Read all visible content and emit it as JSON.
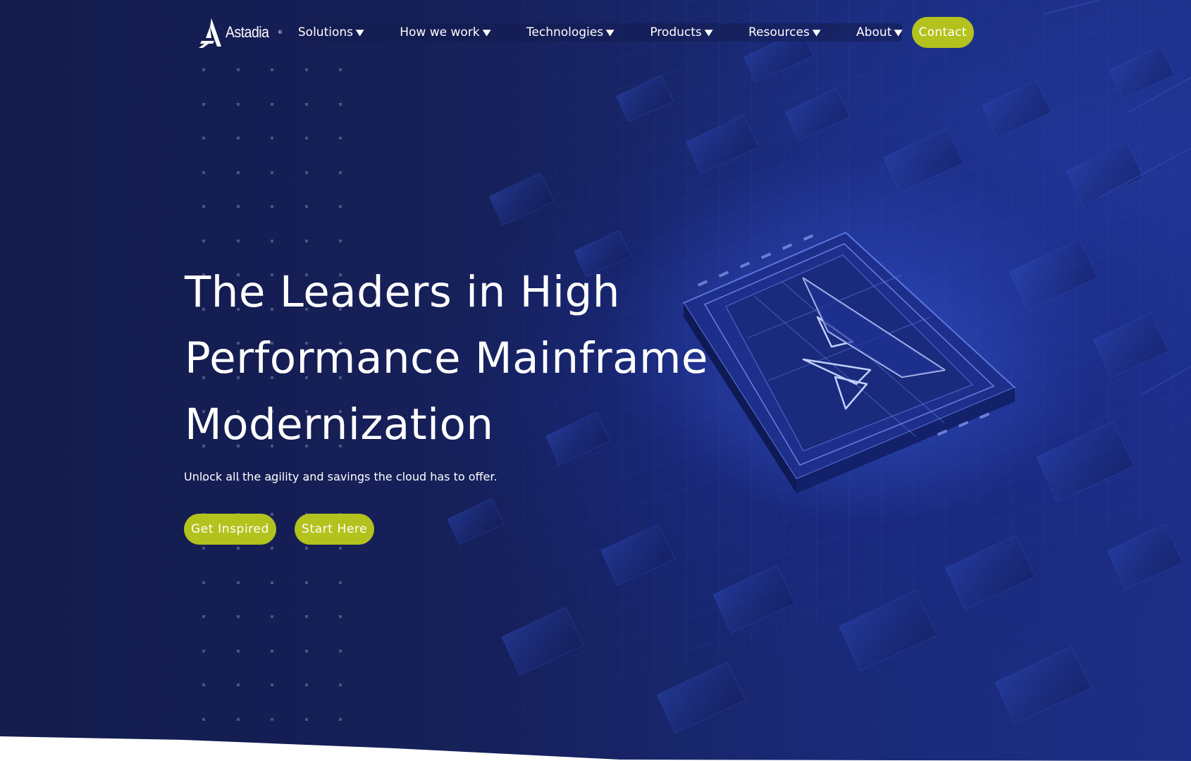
{
  "brand": {
    "name": "Astadia",
    "mark": "®"
  },
  "nav": {
    "items": [
      {
        "label": "Solutions"
      },
      {
        "label": "How we work"
      },
      {
        "label": "Technologies"
      },
      {
        "label": "Products"
      },
      {
        "label": "Resources"
      },
      {
        "label": "About"
      }
    ],
    "contact_label": "Contact"
  },
  "hero": {
    "headline_lines": [
      "The Leaders in High",
      "Performance Mainframe",
      "Modernization"
    ],
    "subtitle": "Unlock all the agility and savings the cloud has to offer.",
    "cta_primary": "Get Inspired",
    "cta_secondary": "Start Here"
  },
  "icons": {
    "caret": "chevron-down-icon",
    "logo": "astadia-logo-icon"
  },
  "colors": {
    "accent": "#b3c21d",
    "background": "#16205a",
    "text": "#ffffff"
  }
}
